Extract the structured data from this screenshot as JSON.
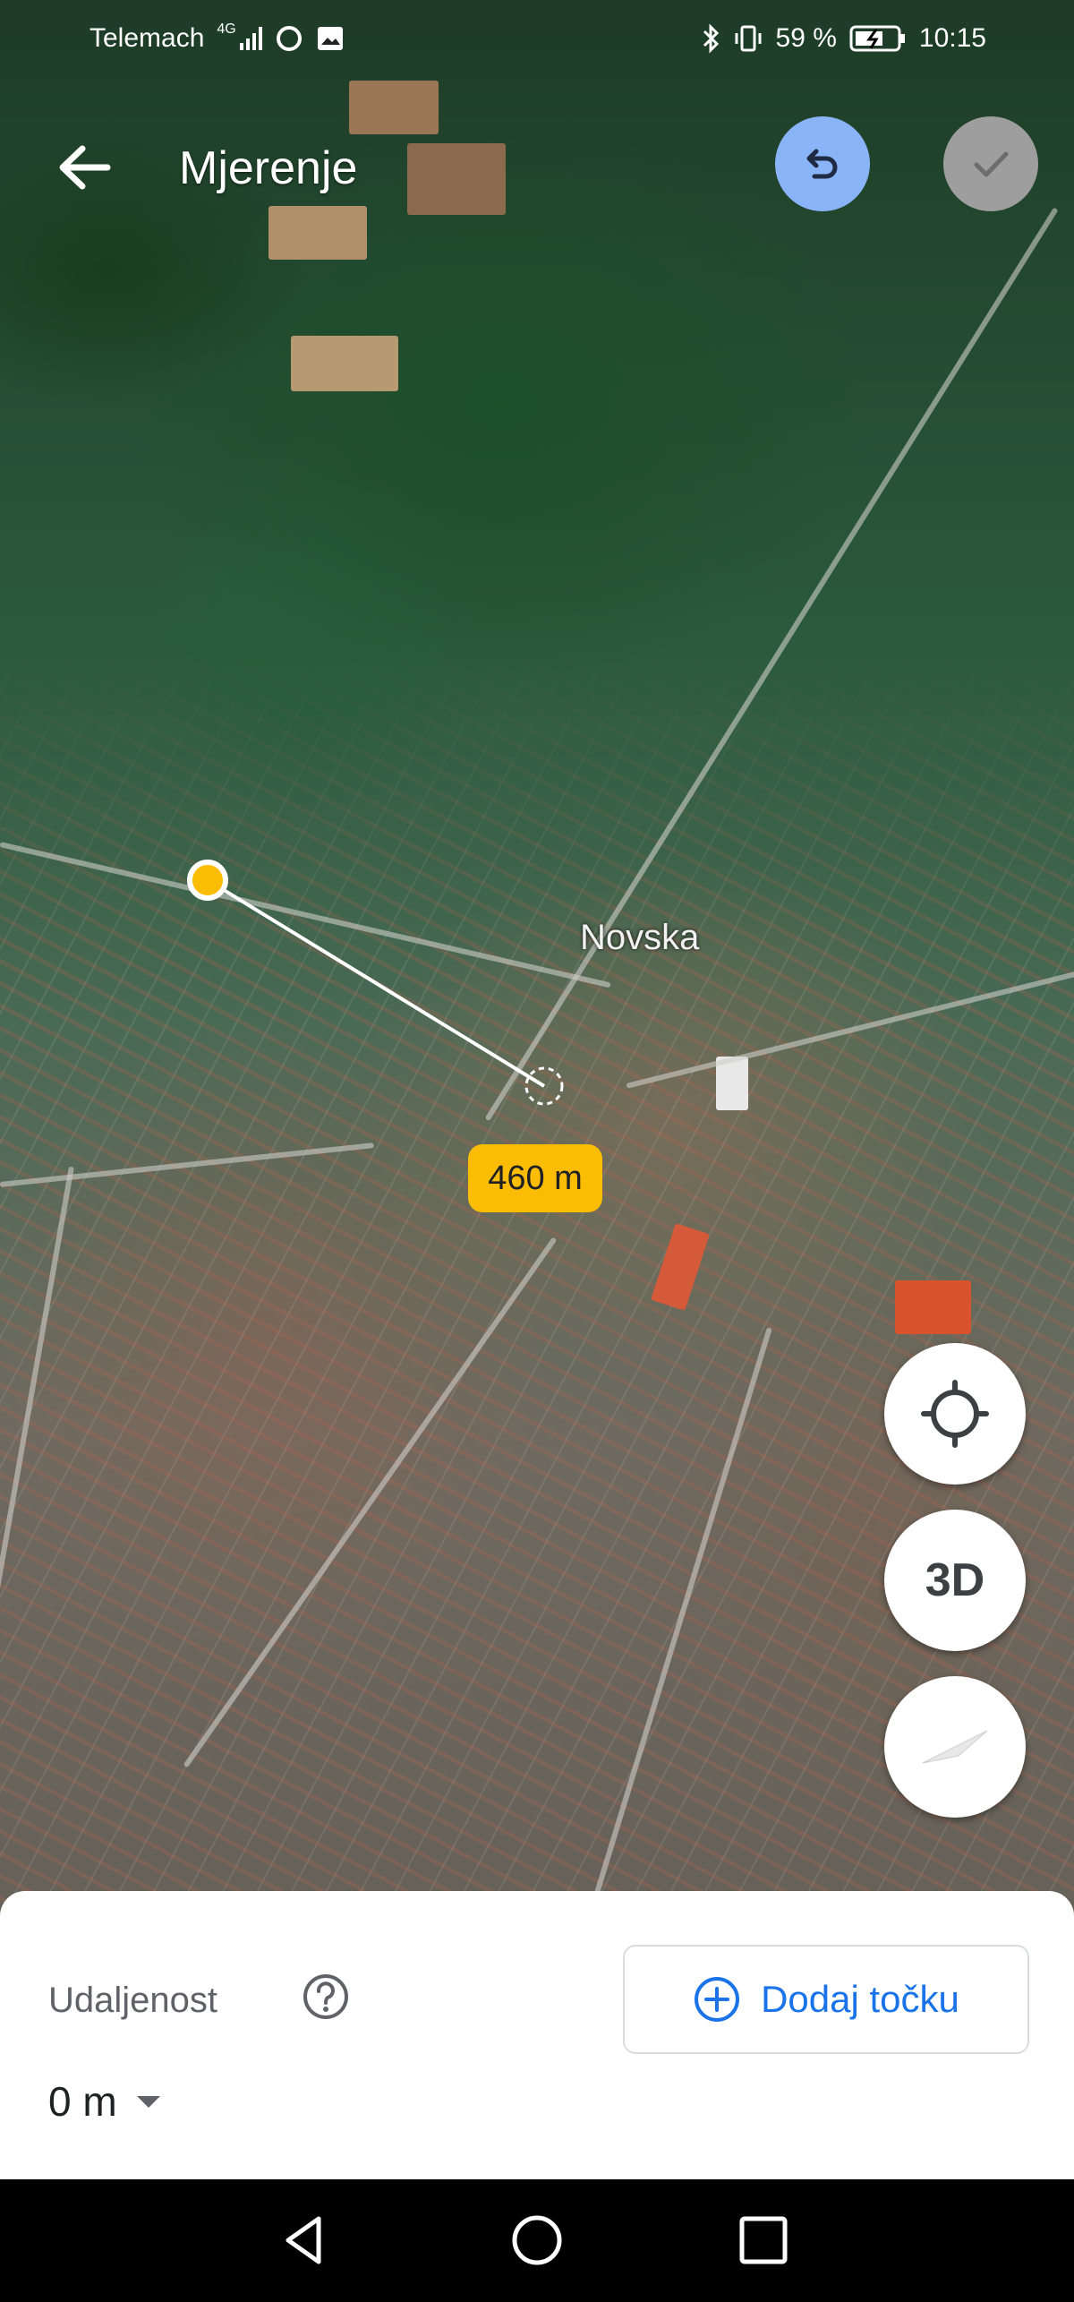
{
  "status_bar": {
    "carrier": "Telemach",
    "network": "4G",
    "battery": "59 %",
    "time": "10:15"
  },
  "header": {
    "title": "Mjerenje",
    "back_icon": "arrow-left-icon",
    "undo_icon": "undo-icon",
    "confirm_icon": "check-icon"
  },
  "map": {
    "place_label": "Novska",
    "distance_label": "460 m"
  },
  "map_controls": {
    "locate_icon": "crosshair-icon",
    "three_d_label": "3D",
    "compass_icon": "compass-icon"
  },
  "bottom_sheet": {
    "distance_title": "Udaljenost",
    "help_icon": "question-icon",
    "add_point_label": "Dodaj točku",
    "add_point_icon": "plus-circle-icon",
    "distance_value": "0 m"
  },
  "colors": {
    "accent": "#1a73e8",
    "undo_bg": "#8ab4f8",
    "distance_badge": "#fbbc04",
    "confirm_disabled": "#9e9e9e"
  }
}
